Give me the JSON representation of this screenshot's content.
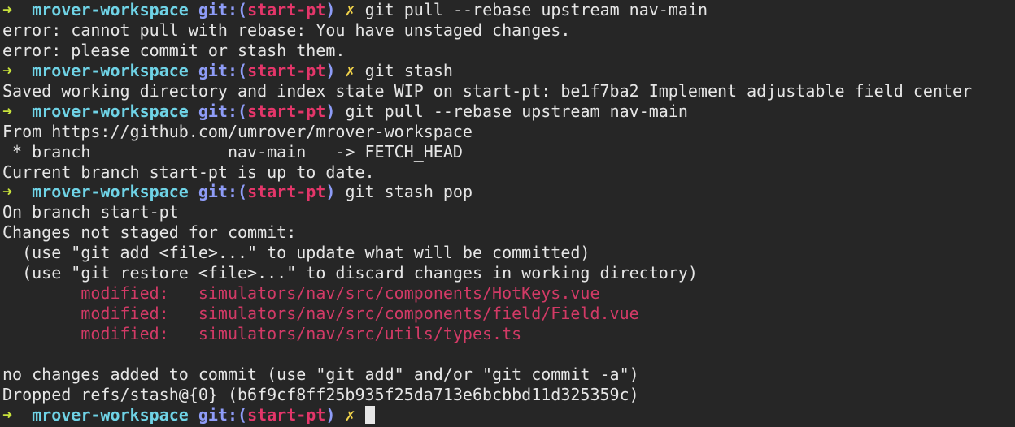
{
  "terminal": {
    "prompt": {
      "arrow": "➜",
      "dir": "mrover-workspace",
      "git_open": "git:(",
      "branch": "start-pt",
      "git_close": ")",
      "dirty": "✗"
    },
    "lines": {
      "l1_cmd": "git pull --rebase upstream nav-main",
      "l2": "error: cannot pull with rebase: You have unstaged changes.",
      "l3": "error: please commit or stash them.",
      "l4_cmd": "git stash",
      "l5": "Saved working directory and index state WIP on start-pt: be1f7ba2 Implement adjustable field center",
      "l6_cmd": "git pull --rebase upstream nav-main",
      "l7": "From https://github.com/umrover/mrover-workspace",
      "l8": " * branch              nav-main   -> FETCH_HEAD",
      "l9": "Current branch start-pt is up to date.",
      "l10_cmd": "git stash pop",
      "l11": "On branch start-pt",
      "l12": "Changes not staged for commit:",
      "l13": "  (use \"git add <file>...\" to update what will be committed)",
      "l14": "  (use \"git restore <file>...\" to discard changes in working directory)",
      "mod_label": "modified:",
      "l15_file": "simulators/nav/src/components/HotKeys.vue",
      "l16_file": "simulators/nav/src/components/field/Field.vue",
      "l17_file": "simulators/nav/src/utils/types.ts",
      "l19": "no changes added to commit (use \"git add\" and/or \"git commit -a\")",
      "l20": "Dropped refs/stash@{0} (b6f9cf8ff25b935f25da713e6bcbbd11d325359c)"
    },
    "colors": {
      "background": "#262626",
      "arrow": "#c8e23c",
      "dir": "#6fd3e6",
      "git": "#8e9cf7",
      "branch": "#e4366a",
      "dirty": "#f0d24a",
      "modified": "#d23a66",
      "text": "#e6e6e6"
    }
  }
}
